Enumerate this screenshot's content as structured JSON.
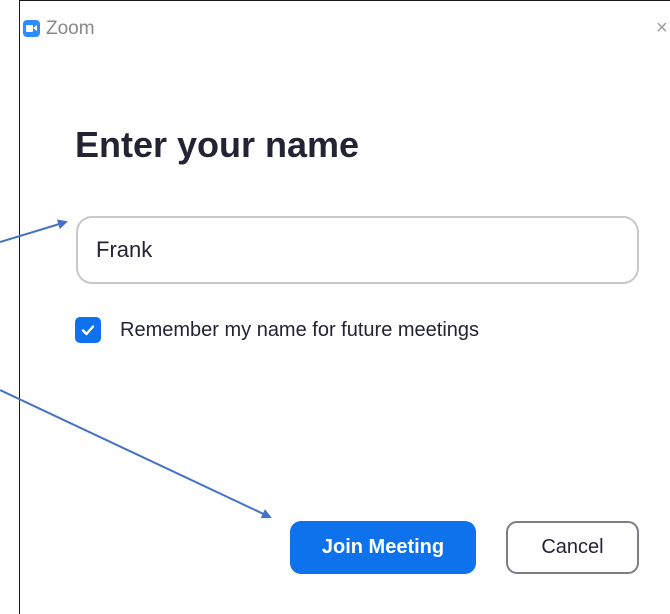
{
  "window": {
    "app_title": "Zoom",
    "close_glyph": "×"
  },
  "dialog": {
    "heading": "Enter your name",
    "name_input_value": "Frank",
    "remember_checked": true,
    "remember_label": "Remember my name for future meetings",
    "join_label": "Join Meeting",
    "cancel_label": "Cancel"
  },
  "icons": {
    "app_logo": "zoom-camera-icon",
    "close": "close-icon",
    "checkbox": "checkmark-icon"
  },
  "colors": {
    "accent": "#0e72ed",
    "logo": "#2d8cff",
    "heading_text": "#232333",
    "annotation_arrow": "#4472c4"
  }
}
